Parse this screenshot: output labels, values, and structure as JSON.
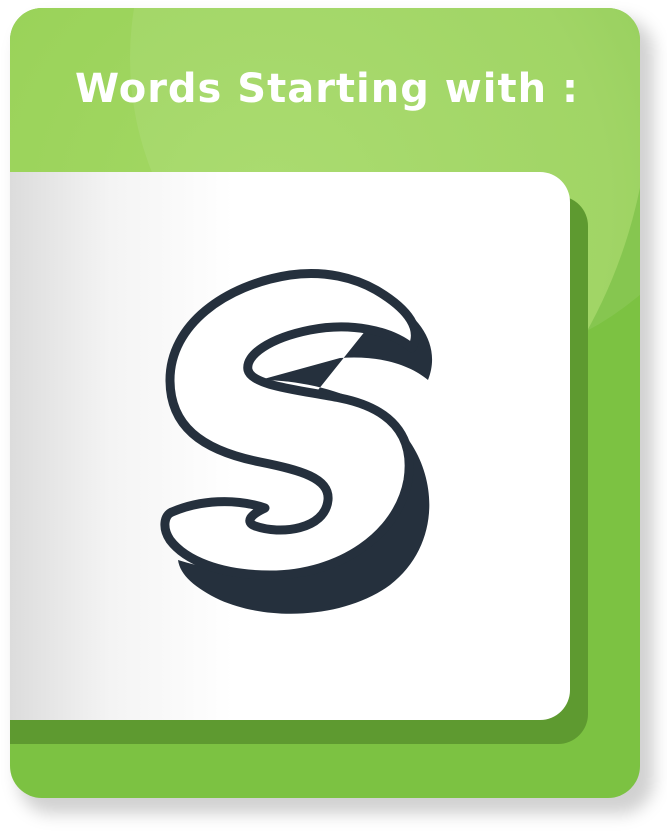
{
  "card": {
    "title": "Words Starting with :",
    "letter": "S",
    "colors": {
      "card_green": "#7cc242",
      "highlight_green": "#a8db68",
      "depth_green": "#5e9a30",
      "tile": "#ffffff",
      "letter_ink": "#25303d"
    },
    "icons": {
      "letter_glyph": "s-letter-icon"
    }
  }
}
